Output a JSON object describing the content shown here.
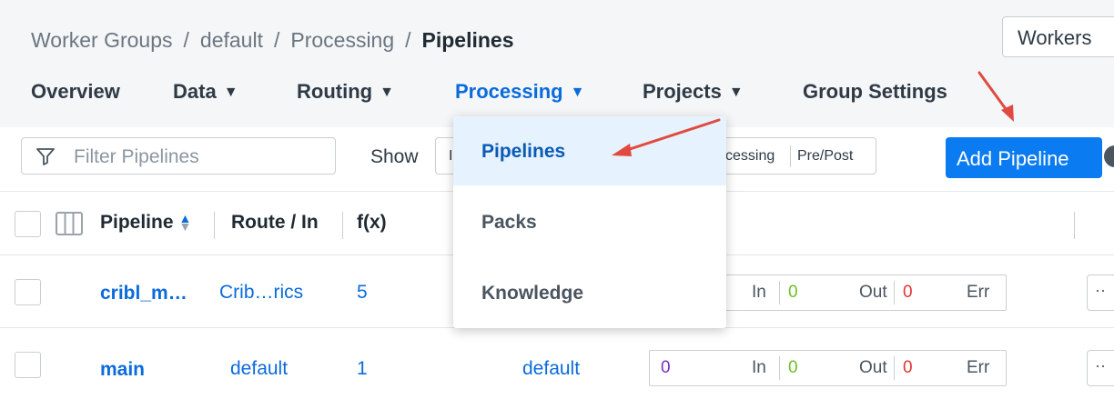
{
  "breadcrumb": {
    "items": [
      "Worker Groups",
      "default",
      "Processing"
    ],
    "current": "Pipelines",
    "separator": "/"
  },
  "workers_button": {
    "label": "Workers"
  },
  "nav": {
    "items": [
      {
        "label": "Overview",
        "caret": ""
      },
      {
        "label": "Data",
        "caret": "▼"
      },
      {
        "label": "Routing",
        "caret": "▼"
      },
      {
        "label": "Processing",
        "caret": "▼"
      },
      {
        "label": "Projects",
        "caret": "▼"
      },
      {
        "label": "Group Settings",
        "caret": ""
      }
    ],
    "active": "Processing"
  },
  "toolbar": {
    "filter_placeholder": "Filter Pipelines",
    "show_label": "Show",
    "segment_partial_left": "I",
    "segment_items": [
      "cessing",
      "Pre/Post"
    ],
    "add_button": "Add Pipeline"
  },
  "table": {
    "headers": {
      "pipeline": "Pipeline",
      "route": "Route / In",
      "fx": "f(x)"
    },
    "rows": [
      {
        "name": "cribl_m…",
        "route": "Crib…rics",
        "functions": "5",
        "output": "",
        "in_value": "",
        "in_label": "In",
        "out_value": "0",
        "out_label": "Out",
        "err_value": "0",
        "err_label": "Err"
      },
      {
        "name": "main",
        "route": "default",
        "functions": "1",
        "output": "default",
        "in_value": "0",
        "in_label": "In",
        "out_value": "0",
        "out_label": "Out",
        "err_value": "0",
        "err_label": "Err"
      }
    ],
    "more_label": "··"
  },
  "dropdown": {
    "items": [
      "Pipelines",
      "Packs",
      "Knowledge"
    ],
    "selected": "Pipelines"
  },
  "colors": {
    "accent": "#0a7bf0",
    "link": "#0a6bdc",
    "annotation_arrow": "#e04a3f",
    "in_value": "#7b2fbf",
    "out_value": "#6cbf2a",
    "err_value": "#e3342f"
  }
}
